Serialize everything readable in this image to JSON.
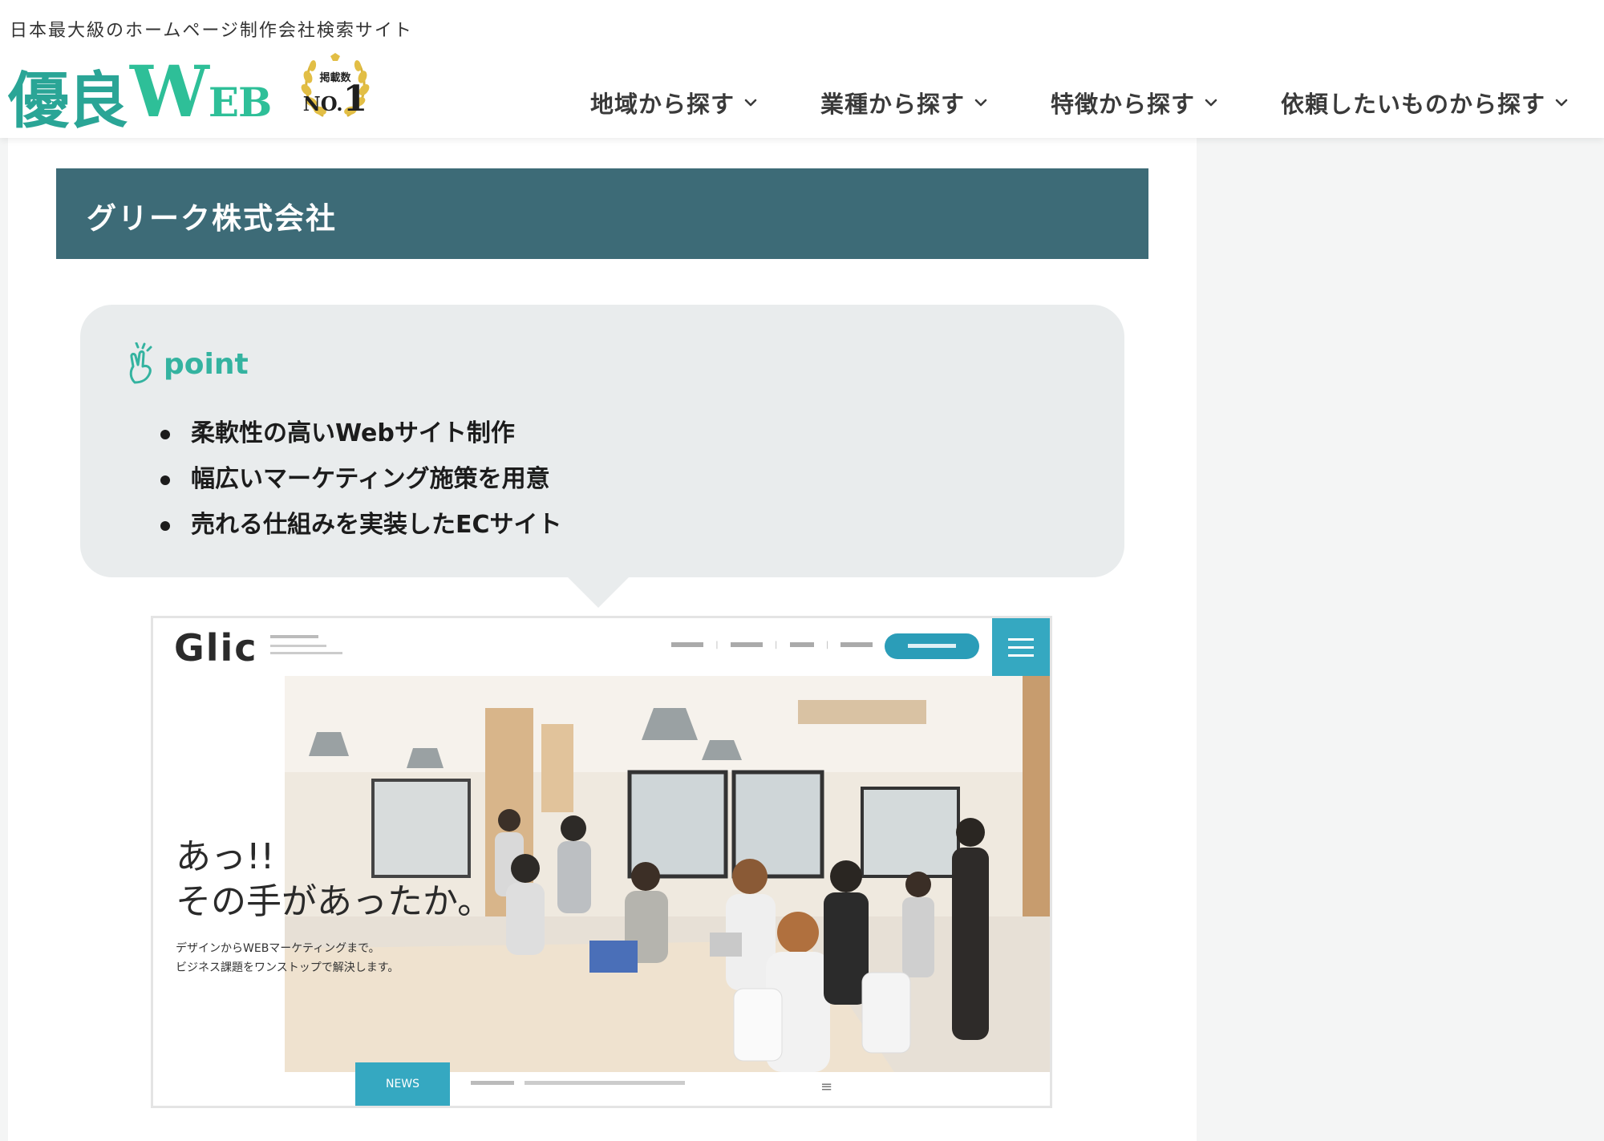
{
  "header": {
    "tagline": "日本最大級のホームページ制作会社検索サイト",
    "logo": {
      "kanji": "優良",
      "web_w": "W",
      "web_rest": "EB",
      "badge_top": "掲載数",
      "badge_no": "NO.",
      "badge_num": "1"
    },
    "nav": [
      {
        "label": "地域から探す"
      },
      {
        "label": "業種から探す"
      },
      {
        "label": "特徴から探す"
      },
      {
        "label": "依頼したいものから探す"
      }
    ]
  },
  "main": {
    "company_name": "グリーク株式会社",
    "point": {
      "label": "point",
      "items": [
        "柔軟性の高いWebサイト制作",
        "幅広いマーケティング施策を用意",
        "売れる仕組みを実装したECサイト"
      ]
    },
    "screenshot": {
      "logo": "Glic",
      "headline_1": "あっ!!",
      "headline_2": "その手があったか。",
      "sub_1": "デザインからWEBマーケティングまで。",
      "sub_2": "ビジネス課題をワンストップで解決します。",
      "news": "NEWS"
    }
  },
  "colors": {
    "brand_teal": "#2aa596",
    "banner": "#3d6b77",
    "point_accent": "#34b3a0",
    "point_box": "#e9eced",
    "glic_blue": "#35a8c1"
  }
}
